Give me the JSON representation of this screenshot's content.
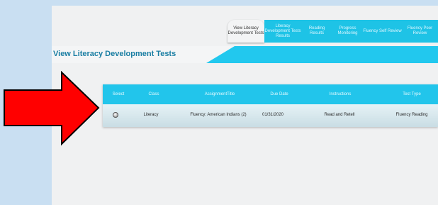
{
  "tabs": [
    {
      "label_line1": "View Literacy",
      "label_line2": "Development Tests",
      "active": true
    },
    {
      "label_line1": "Literacy",
      "label_line2": "Development Tests",
      "label_line3": "Results",
      "active": false
    },
    {
      "label": "Reading Results",
      "active": false
    },
    {
      "label": "Progress Monitoring",
      "active": false
    },
    {
      "label": "Fluency Self Review",
      "active": false
    },
    {
      "label_line1": "Fluency Peer",
      "label_line2": "Review",
      "active": false
    }
  ],
  "page_title": "View Literacy Development Tests",
  "table": {
    "headers": [
      "Select",
      "Class",
      "AssignmentTitle",
      "Due Date",
      "Instructions",
      "Test Type"
    ],
    "rows": [
      {
        "class": "Literacy",
        "assignment_title": "Fluency: American Indians (2)",
        "due_date": "01/31/2020",
        "instructions": "Read and Retell",
        "test_type": "Fluency Reading"
      }
    ]
  },
  "colors": {
    "accent": "#22c5eb",
    "title_text": "#1a7ea3",
    "arrow": "#ff0000",
    "background": "#c9dff2"
  },
  "icons": [
    "radio-button-icon",
    "red-arrow-icon"
  ]
}
